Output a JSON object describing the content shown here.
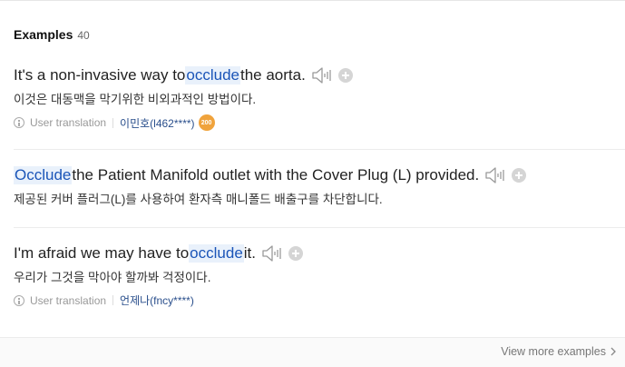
{
  "header": {
    "title": "Examples",
    "count": "40"
  },
  "examples": [
    {
      "en_before": "It's a non-invasive way to ",
      "en_highlight": "occlude",
      "en_after": " the aorta.",
      "ko": "이것은 대동맥을 막기위한 비외과적인 방법이다.",
      "meta_label": "User translation",
      "user": "이민호(l462****)",
      "badge": "200"
    },
    {
      "en_before": "",
      "en_highlight": "Occlude",
      "en_after": " the Patient Manifold outlet with the Cover Plug (L) provided.",
      "ko": "제공된 커버 플러그(L)를 사용하여 환자측 매니폴드 배출구를 차단합니다."
    },
    {
      "en_before": "I'm afraid we may have to ",
      "en_highlight": "occlude",
      "en_after": " it.",
      "ko": "우리가 그것을 막아야 할까봐 걱정이다.",
      "meta_label": "User translation",
      "user": "언제나(fncy****)"
    }
  ],
  "footer": {
    "view_more": "View more examples"
  },
  "icons": {
    "audio": "speaker-icon",
    "add": "plus-icon",
    "info": "info-icon",
    "more": "chevron-right-icon"
  },
  "colors": {
    "highlight_bg": "#e9f1fb",
    "highlight_text": "#1b55b8",
    "badge": "#f0a33c",
    "user_link": "#2a4f8c"
  }
}
